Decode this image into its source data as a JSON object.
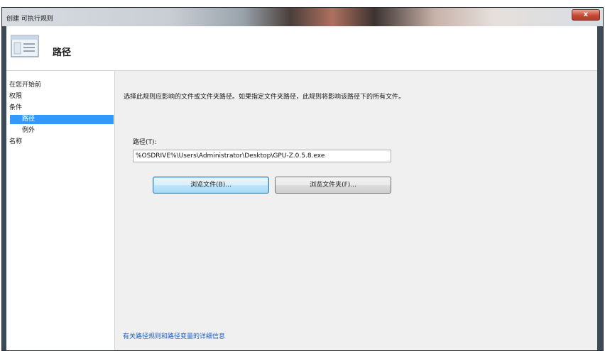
{
  "window": {
    "title": "创建 可执行规则",
    "close_label": "x"
  },
  "header": {
    "title": "路径",
    "icon": "rules-list-icon"
  },
  "nav": {
    "items": [
      {
        "label": "在您开始前"
      },
      {
        "label": "权限"
      },
      {
        "label": "条件"
      },
      {
        "label": "路径"
      },
      {
        "label": "例外"
      },
      {
        "label": "名称"
      }
    ],
    "selected": "路径"
  },
  "main": {
    "description": "选择此规则应影响的文件或文件夹路径。如果指定文件夹路径，此规则将影响该路径下的所有文件。",
    "path_label": "路径(T):",
    "path_value": "%OSDRIVE%\\Users\\Administrator\\Desktop\\GPU-Z.0.5.8.exe",
    "browse_files_label": "浏览文件(B)...",
    "browse_folders_label": "浏览文件夹(F)...",
    "help_link": "有关路径规则和路径变量的详细信息"
  },
  "colors": {
    "selection": "#3399ff",
    "link": "#1f5fbf",
    "panel": "#f0f0f0"
  }
}
